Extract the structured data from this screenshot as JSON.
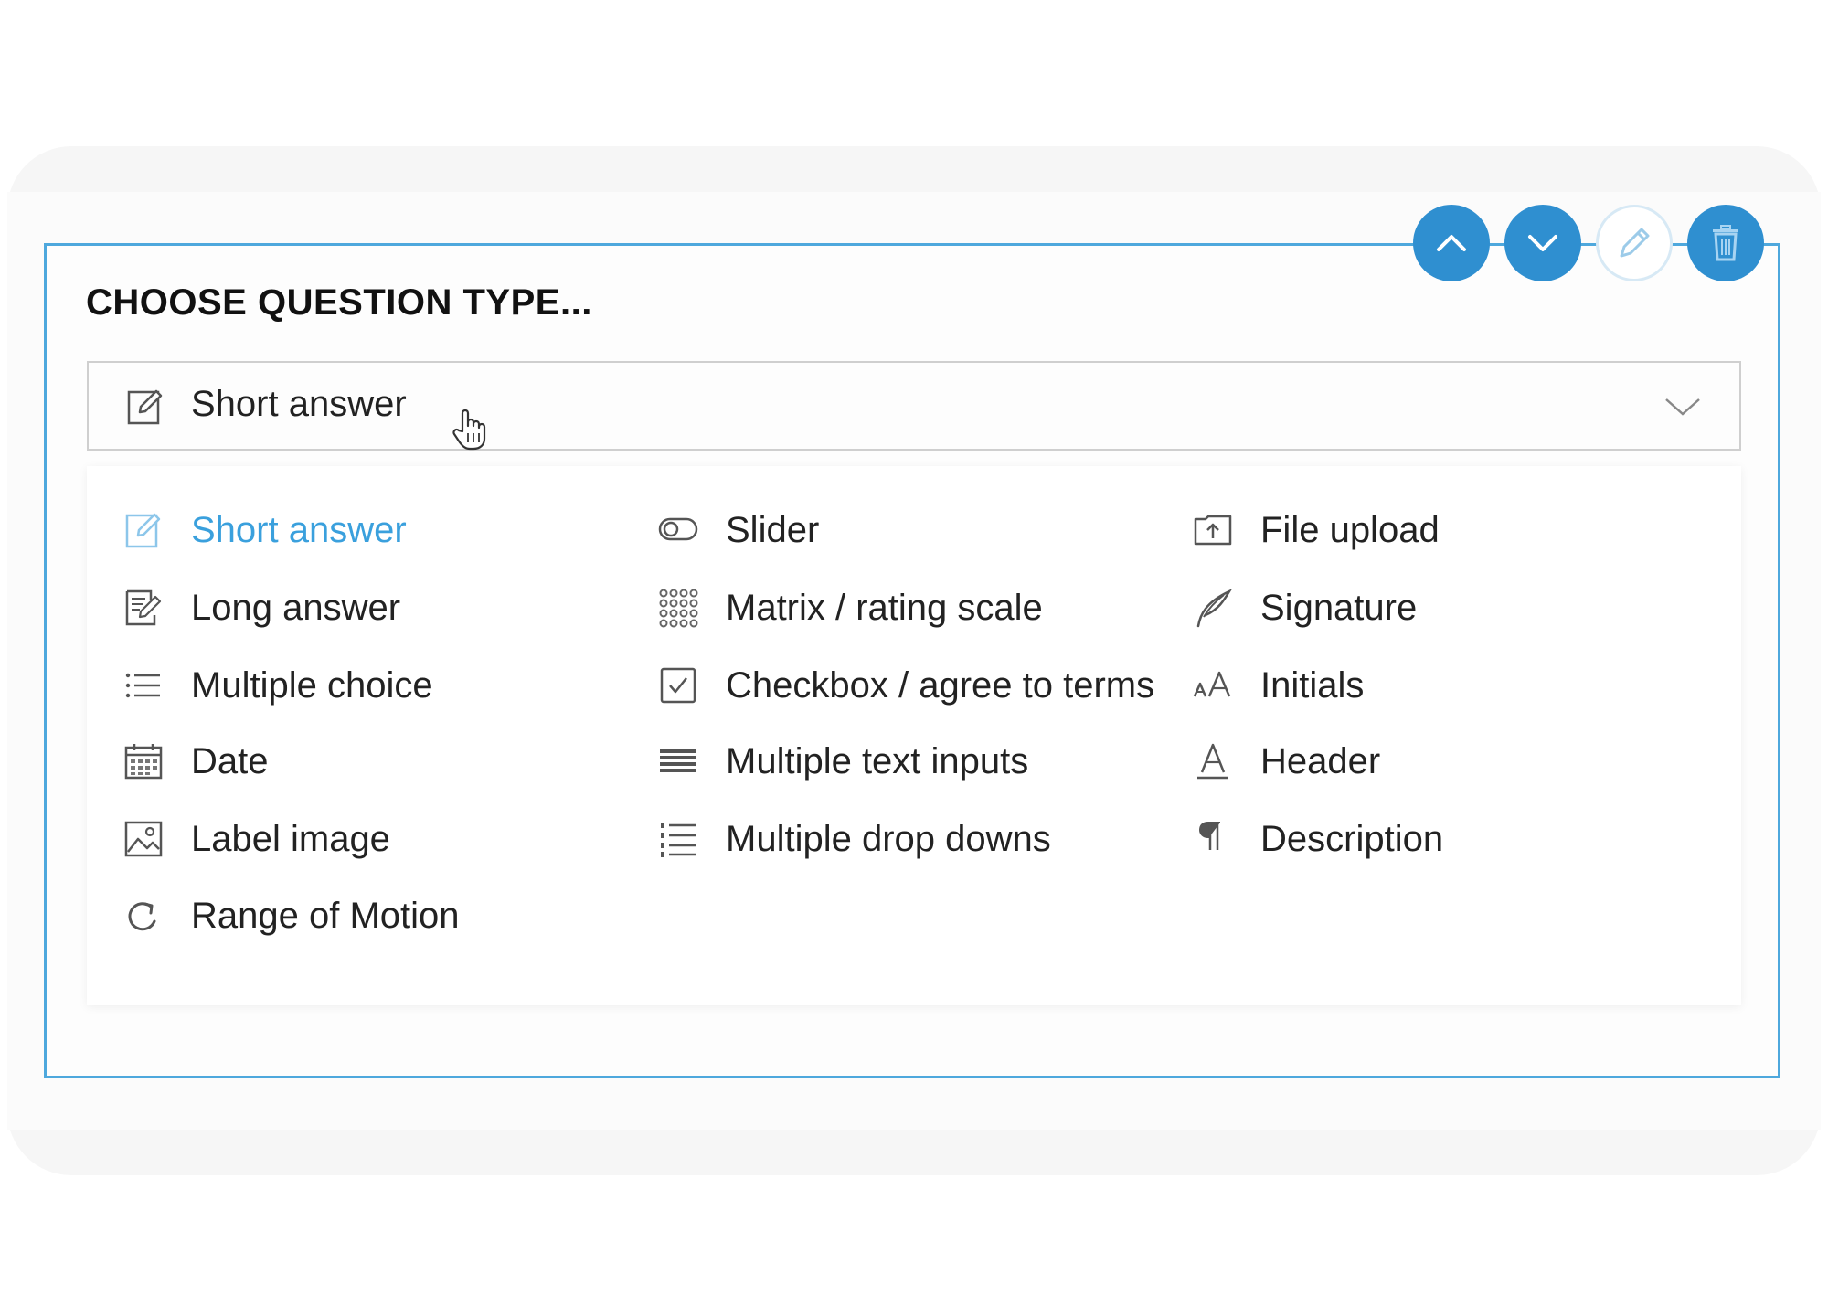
{
  "title": "CHOOSE QUESTION TYPE...",
  "select": {
    "value": "Short answer",
    "icon": "edit-square-icon"
  },
  "controls": [
    {
      "name": "move-up-icon"
    },
    {
      "name": "move-down-icon"
    },
    {
      "name": "pencil-icon"
    },
    {
      "name": "trash-icon"
    }
  ],
  "colors": {
    "accent": "#2f8fd0",
    "active_text": "#3aa0dd",
    "card_border": "#4ea8dd"
  },
  "options": {
    "col1": [
      {
        "label": "Short answer",
        "icon": "edit-square-icon",
        "active": true
      },
      {
        "label": "Long answer",
        "icon": "document-edit-icon"
      },
      {
        "label": "Multiple choice",
        "icon": "list-icon"
      },
      {
        "label": "Date",
        "icon": "calendar-icon"
      },
      {
        "label": "Label image",
        "icon": "image-icon"
      },
      {
        "label": "Range of Motion",
        "icon": "rotate-icon"
      }
    ],
    "col2": [
      {
        "label": "Slider",
        "icon": "toggle-icon"
      },
      {
        "label": "Matrix / rating scale",
        "icon": "grid-dots-icon"
      },
      {
        "label": "Checkbox / agree to terms",
        "icon": "checkbox-icon"
      },
      {
        "label": "Multiple text inputs",
        "icon": "lines-icon"
      },
      {
        "label": "Multiple drop downs",
        "icon": "numbered-list-icon"
      }
    ],
    "col3": [
      {
        "label": "File upload",
        "icon": "upload-icon"
      },
      {
        "label": "Signature",
        "icon": "feather-pen-icon"
      },
      {
        "label": "Initials",
        "icon": "text-size-icon"
      },
      {
        "label": "Header",
        "icon": "header-a-icon"
      },
      {
        "label": "Description",
        "icon": "paragraph-icon"
      }
    ]
  }
}
